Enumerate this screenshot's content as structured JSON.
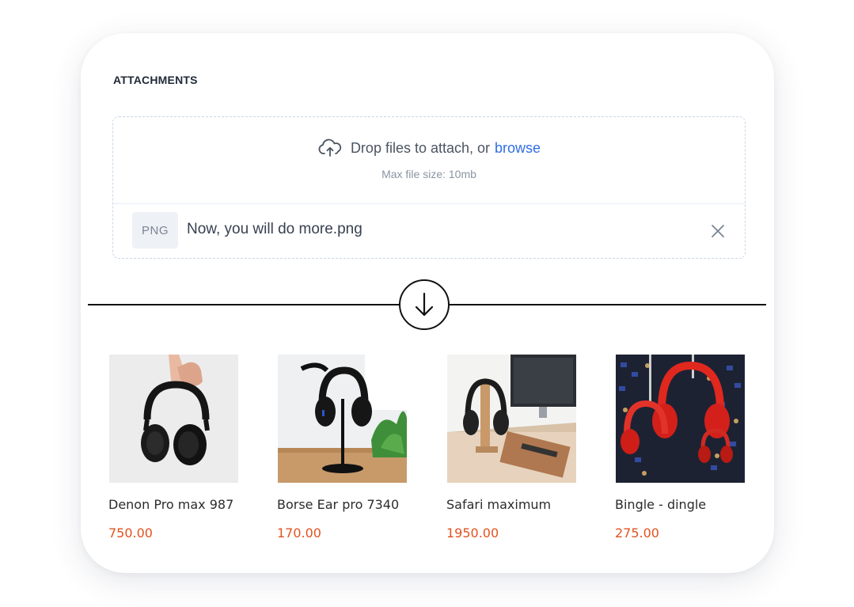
{
  "attachments": {
    "title": "ATTACHMENTS",
    "drop_text": "Drop files to attach, or",
    "browse_label": "browse",
    "max_size_text": "Max file size: 10mb",
    "file": {
      "type_badge": "PNG",
      "name": "Now, you will do more.png"
    }
  },
  "icons": {
    "upload": "cloud-upload-icon",
    "remove": "close-icon",
    "divider": "arrow-down-icon"
  },
  "colors": {
    "accent_link": "#2f6fe4",
    "price": "#e2521f"
  },
  "products": [
    {
      "name": "Denon Pro max 987",
      "price": "750.00",
      "image": "hand-holding-black-headphones"
    },
    {
      "name": "Borse Ear pro 7340",
      "price": "170.00",
      "image": "headphones-on-stand"
    },
    {
      "name": "Safari maximum",
      "price": "1950.00",
      "image": "headphones-on-desk-stand"
    },
    {
      "name": "Bingle - dingle",
      "price": "275.00",
      "image": "red-hanging-headphones"
    }
  ]
}
